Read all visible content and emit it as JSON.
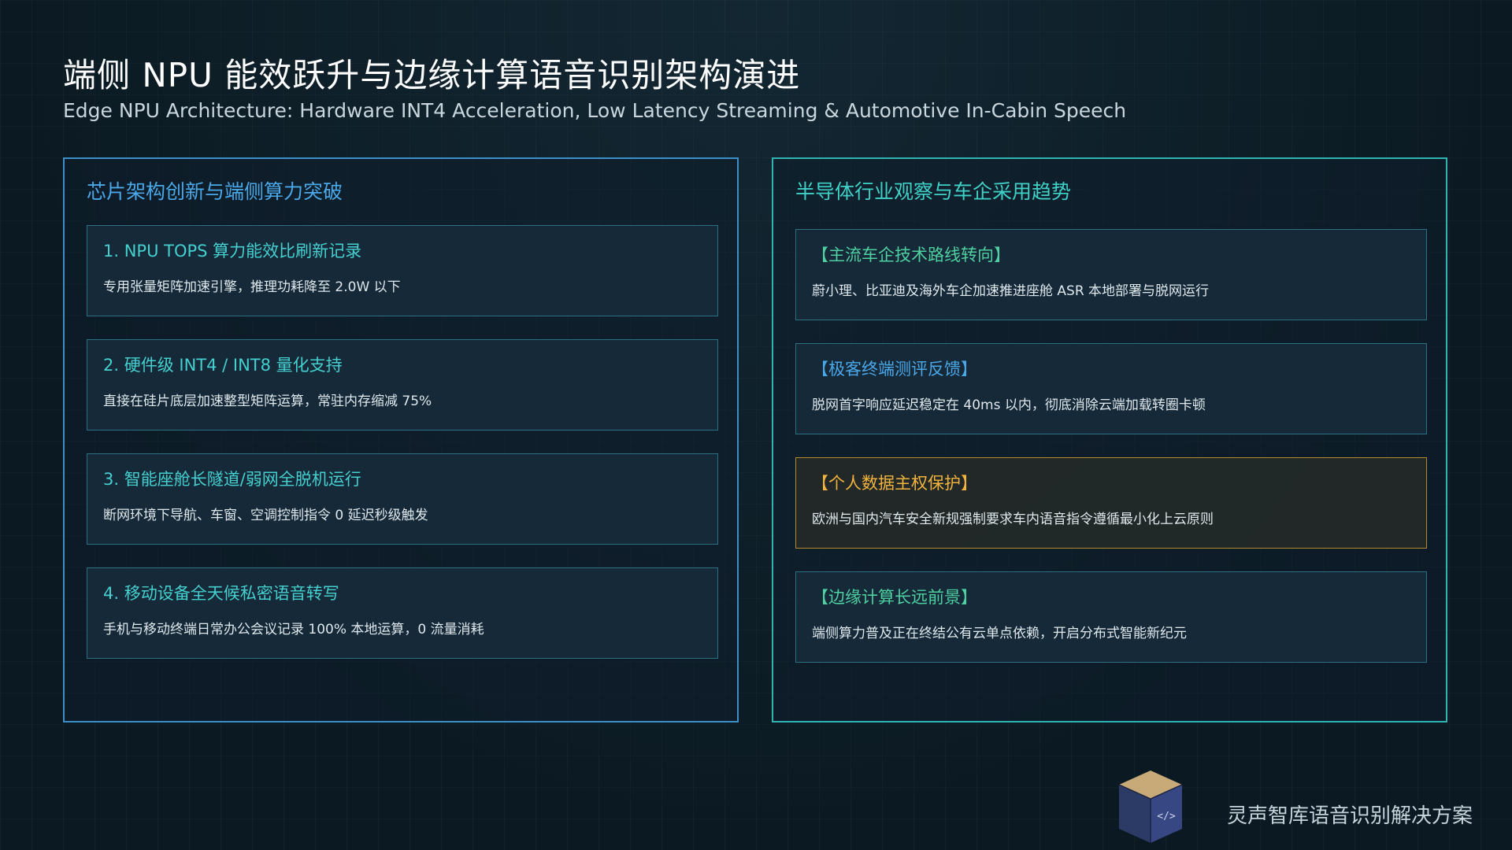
{
  "header": {
    "title": "端侧 NPU 能效跃升与边缘计算语音识别架构演进",
    "subtitle": "Edge NPU Architecture: Hardware INT4 Acceleration, Low Latency Streaming & Automotive In-Cabin Speech"
  },
  "left_panel": {
    "heading": "芯片架构创新与端侧算力突破",
    "cards": [
      {
        "title": "1. NPU TOPS 算力能效比刷新记录",
        "desc": "专用张量矩阵加速引擎，推理功耗降至 2.0W 以下"
      },
      {
        "title": "2. 硬件级 INT4 / INT8 量化支持",
        "desc": "直接在硅片底层加速整型矩阵运算，常驻内存缩减 75%"
      },
      {
        "title": "3. 智能座舱长隧道/弱网全脱机运行",
        "desc": "断网环境下导航、车窗、空调控制指令 0 延迟秒级触发"
      },
      {
        "title": "4. 移动设备全天候私密语音转写",
        "desc": "手机与移动终端日常办公会议记录 100% 本地运算，0 流量消耗"
      }
    ]
  },
  "right_panel": {
    "heading": "半导体行业观察与车企采用趋势",
    "cards": [
      {
        "title": "【主流车企技术路线转向】",
        "desc": "蔚小理、比亚迪及海外车企加速推进座舱 ASR 本地部署与脱网运行"
      },
      {
        "title": "【极客终端测评反馈】",
        "desc": "脱网首字响应延迟稳定在 40ms 以内，彻底消除云端加载转圈卡顿"
      },
      {
        "title": "【个人数据主权保护】",
        "desc": "欧洲与国内汽车安全新规强制要求车内语音指令遵循最小化上云原则"
      },
      {
        "title": "【边缘计算长远前景】",
        "desc": "端侧算力普及正在终结公有云单点依赖，开启分布式智能新纪元"
      }
    ]
  },
  "footer": {
    "logo_icon": "code-cube-icon",
    "brand": "灵声智库语音识别解决方案"
  },
  "colors": {
    "left_border": "#3d8fc7",
    "right_border": "#2fb3b3",
    "cyan": "#45d0cf",
    "blue": "#4aa8e8",
    "green": "#4ed0a0",
    "gold": "#f2b43c"
  }
}
